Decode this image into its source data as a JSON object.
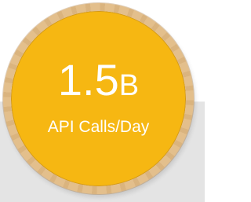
{
  "stat": {
    "number": "1.5",
    "suffix": "B",
    "label": "API Calls/Day"
  },
  "colors": {
    "circle_fill": "#f6b712",
    "rim": "#e3bf8c",
    "text": "#ffffff",
    "background_band": "#e4e4e4"
  }
}
